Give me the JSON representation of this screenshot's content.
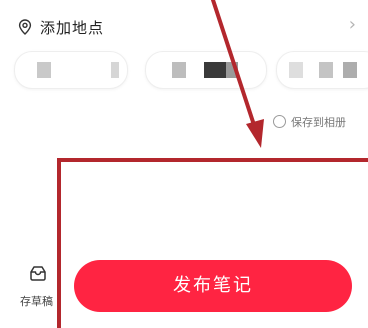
{
  "location": {
    "label": "添加地点",
    "pin_icon": "location-pin-icon",
    "chevron_icon": "chevron-right-icon"
  },
  "location_chips": [
    {
      "label": "",
      "blurred": true
    },
    {
      "label": "",
      "blurred": true
    },
    {
      "label": "",
      "blurred": true
    }
  ],
  "save_to_album": {
    "label": "保存到相册",
    "checked": false
  },
  "bottom_bar": {
    "draft_label": "存草稿",
    "draft_icon": "draft-box-icon",
    "publish_label": "发布笔记"
  },
  "colors": {
    "accent": "#ff2442",
    "annotation": "#b3272d"
  }
}
